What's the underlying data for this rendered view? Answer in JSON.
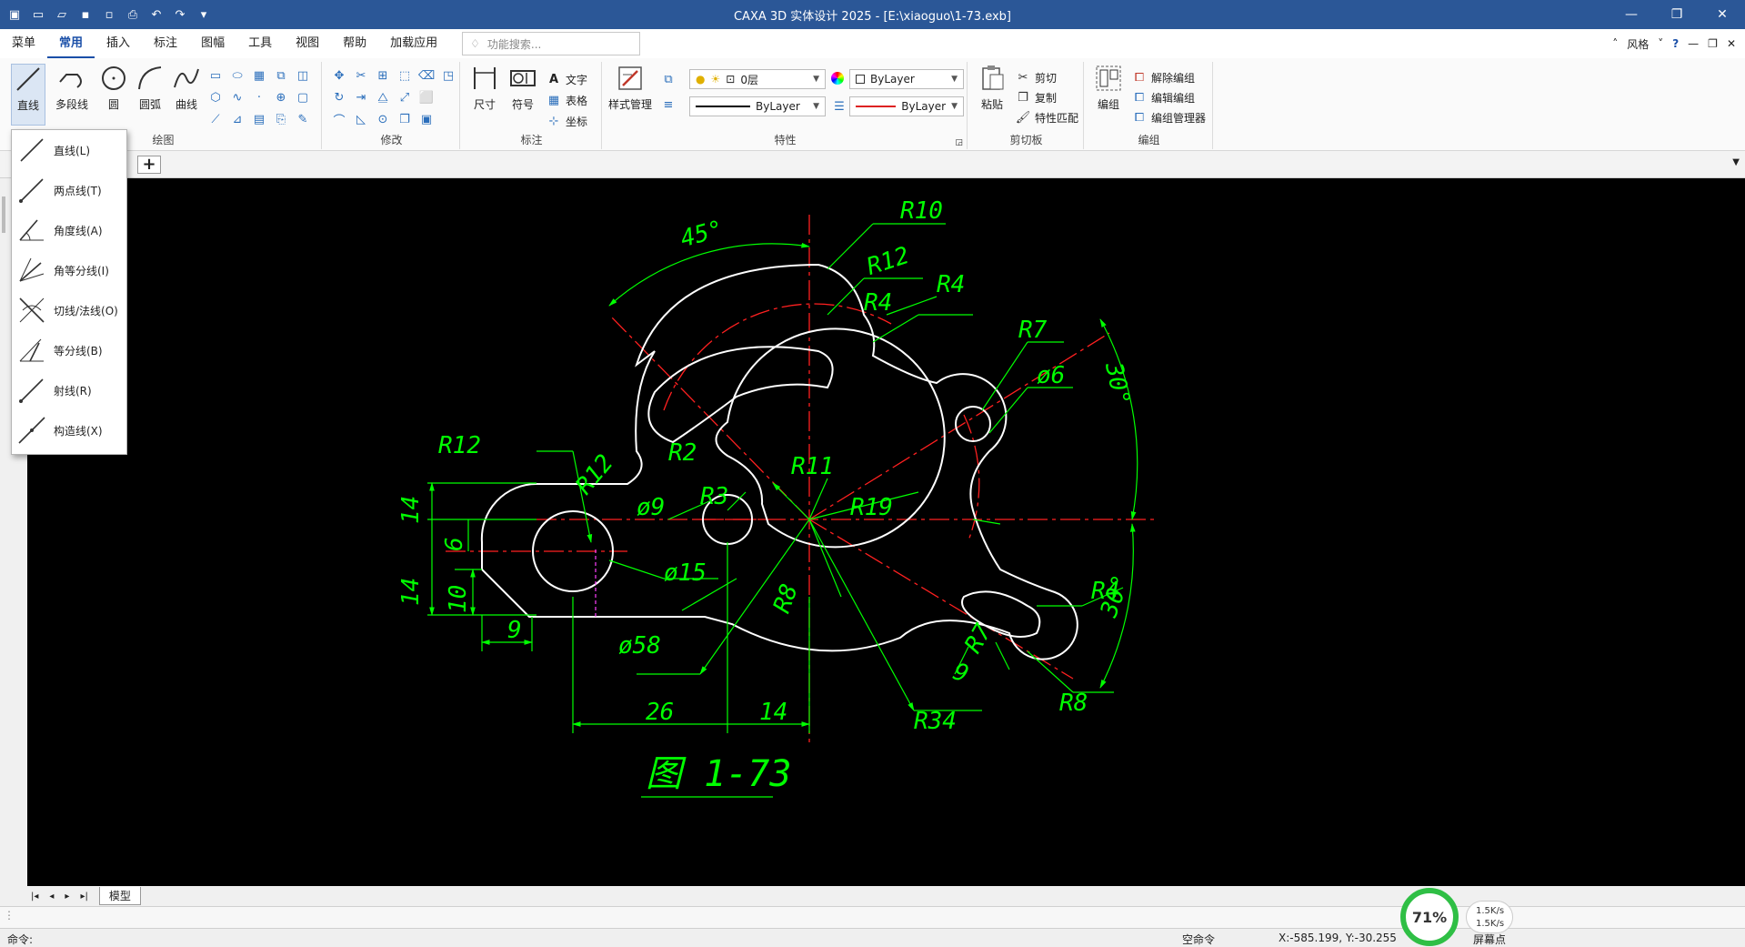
{
  "titlebar": {
    "title": "CAXA 3D 实体设计 2025 - [E:\\xiaoguo\\1-73.exb]"
  },
  "menu": {
    "items": [
      "菜单",
      "常用",
      "插入",
      "标注",
      "图幅",
      "工具",
      "视图",
      "帮助",
      "加载应用"
    ],
    "search_placeholder": "功能搜索...",
    "style_label": "风格"
  },
  "ribbon": {
    "draw": {
      "label": "绘图",
      "buttons": [
        "直线",
        "多段线",
        "圆",
        "圆弧",
        "曲线"
      ]
    },
    "modify": {
      "label": "修改"
    },
    "annotate": {
      "label": "标注",
      "buttons": [
        "尺寸",
        "符号"
      ],
      "small": [
        "文字",
        "表格",
        "坐标"
      ]
    },
    "properties": {
      "label": "特性",
      "style_manager": "样式管理",
      "layer": "0层",
      "color": "ByLayer",
      "linetype": "ByLayer",
      "lineweight": "ByLayer"
    },
    "clipboard": {
      "label": "剪切板",
      "paste": "粘贴",
      "items": [
        "剪切",
        "复制",
        "特性匹配"
      ]
    },
    "group": {
      "label": "编组",
      "button": "编组",
      "items": [
        "解除编组",
        "编辑编组",
        "编组管理器"
      ]
    }
  },
  "line_menu": {
    "items": [
      "直线(L)",
      "两点线(T)",
      "角度线(A)",
      "角等分线(I)",
      "切线/法线(O)",
      "等分线(B)",
      "射线(R)",
      "构造线(X)"
    ]
  },
  "drawing": {
    "dims": {
      "angle_45": "45°",
      "r10": "R10",
      "r12a": "R12",
      "r12b": "R12",
      "r12c": "R12",
      "r4a": "R4",
      "r4b": "R4",
      "r7a": "R7",
      "r7b": "R7",
      "r2": "R2",
      "r3": "R3",
      "r11": "R11",
      "r19": "R19",
      "r8a": "R8",
      "r8b": "R8",
      "r34": "R34",
      "d9": "ø9",
      "d15": "ø15",
      "d6": "ø6",
      "d58": "ø58",
      "angle_30a": "30°",
      "angle_30b": "30°",
      "len_14a": "14",
      "len_14b": "14",
      "len_6": "6",
      "len_10": "10",
      "len_9a": "9",
      "len_9b": "9",
      "len_26": "26",
      "len_14c": "14"
    },
    "caption": "图 1-73"
  },
  "layout_tabs": {
    "model": "模型"
  },
  "status": {
    "command_prompt": "命令:",
    "empty_command": "空命令",
    "coords": "X:-585.199, Y:-30.255",
    "screen_point": "屏幕点",
    "cpu_percent": "71%",
    "net_up": "1.5K/s",
    "net_down": "1.5K/s"
  },
  "colors": {
    "title_bg": "#2b5797",
    "canvas_bg": "#000000",
    "outline": "#ffffff",
    "dimension": "#00ff00",
    "centerline": "#ff0000",
    "accent": "#1a4fa8"
  }
}
